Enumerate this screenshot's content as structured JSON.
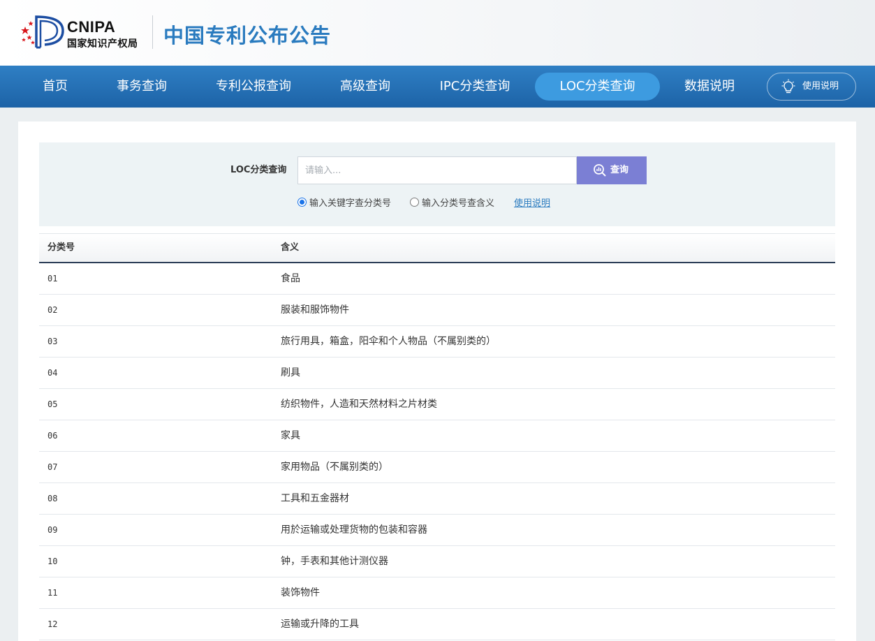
{
  "header": {
    "logo_en": "CNIPA",
    "logo_cn": "国家知识产权局",
    "site_title": "中国专利公布公告"
  },
  "nav": {
    "items": [
      {
        "label": "首页",
        "active": false
      },
      {
        "label": "事务查询",
        "active": false
      },
      {
        "label": "专利公报查询",
        "active": false
      },
      {
        "label": "高级查询",
        "active": false
      },
      {
        "label": "IPC分类查询",
        "active": false
      },
      {
        "label": "LOC分类查询",
        "active": true
      },
      {
        "label": "数据说明",
        "active": false
      }
    ],
    "help_label": "使用说明"
  },
  "search": {
    "label": "LOC分类查询",
    "placeholder": "请输入...",
    "value": "",
    "button_label": "查询",
    "options": [
      {
        "label": "输入关键字查分类号",
        "checked": true
      },
      {
        "label": "输入分类号查含义",
        "checked": false
      }
    ],
    "help_link": "使用说明"
  },
  "table": {
    "columns": [
      "分类号",
      "含义"
    ],
    "rows": [
      {
        "code": "01",
        "meaning": "食品"
      },
      {
        "code": "02",
        "meaning": "服装和服饰物件"
      },
      {
        "code": "03",
        "meaning": "旅行用具，箱盒，阳伞和个人物品（不属别类的）"
      },
      {
        "code": "04",
        "meaning": "刷具"
      },
      {
        "code": "05",
        "meaning": "纺织物件，人造和天然材料之片材类"
      },
      {
        "code": "06",
        "meaning": "家具"
      },
      {
        "code": "07",
        "meaning": "家用物品（不属别类的）"
      },
      {
        "code": "08",
        "meaning": "工具和五金器材"
      },
      {
        "code": "09",
        "meaning": "用於运输或处理货物的包装和容器"
      },
      {
        "code": "10",
        "meaning": "钟，手表和其他计测仪器"
      },
      {
        "code": "11",
        "meaning": "装饰物件"
      },
      {
        "code": "12",
        "meaning": "运输或升降的工具"
      }
    ]
  },
  "colors": {
    "nav_bg": "#1d63a7",
    "nav_active": "#3d9be0",
    "title": "#2a7bbf",
    "search_button": "#7b7fd4",
    "panel_bg": "#edf3f5"
  }
}
